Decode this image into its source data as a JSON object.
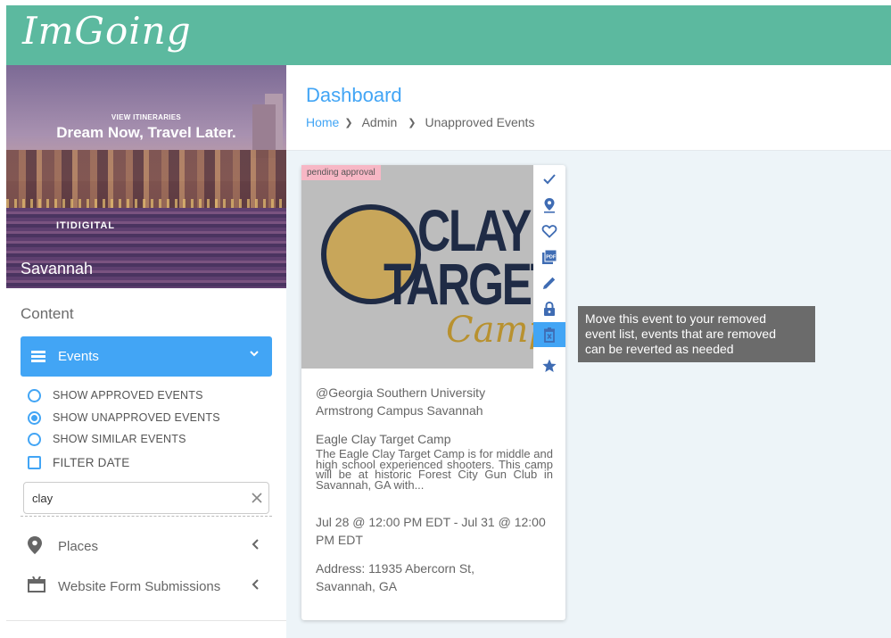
{
  "app": {
    "logo": "ImGoing"
  },
  "hero": {
    "view_label": "VIEW ITINERARIES",
    "headline": "Dream Now, Travel Later.",
    "brand": "ITIDIGITAL",
    "city": "Savannah"
  },
  "sidebar": {
    "content_label": "Content",
    "events_label": "Events",
    "filters": [
      {
        "label": "SHOW APPROVED EVENTS",
        "selected": false
      },
      {
        "label": "SHOW UNAPPROVED EVENTS",
        "selected": true
      },
      {
        "label": "SHOW SIMILAR EVENTS",
        "selected": false
      }
    ],
    "filter_date_label": "FILTER DATE",
    "search_value": "clay",
    "nav": [
      {
        "label": "Places",
        "icon": "map-pin-icon"
      },
      {
        "label": "Website Form Submissions",
        "icon": "inbox-icon"
      }
    ]
  },
  "header": {
    "title": "Dashboard",
    "breadcrumbs": [
      "Home",
      "Admin",
      "Unapproved Events"
    ]
  },
  "card": {
    "badge": "pending approval",
    "logo_lines": [
      "CLAY",
      "TARGET",
      "Camp"
    ],
    "venue_line1": "@Georgia Southern University",
    "venue_line2": "Armstrong Campus Savannah",
    "title": "Eagle Clay Target Camp",
    "description": "The Eagle Clay Target Camp is for middle and high school experienced shooters. This camp will be at historic Forest City Gun Club in Savannah, GA with...",
    "date_line1": "Jul 28 @ 12:00 PM EDT - Jul 31 @ 12:00",
    "date_line2": "PM EDT",
    "address_line1": "Address: 11935 Abercorn St,",
    "address_line2": "Savannah, GA"
  },
  "tooltip": {
    "line1": "Move this event to your removed",
    "line2": "event list, events that are removed",
    "line3": "can be reverted as needed"
  },
  "colors": {
    "brand": "#5cb99f",
    "accent": "#42a5f5",
    "icon": "#3f6cb3"
  }
}
